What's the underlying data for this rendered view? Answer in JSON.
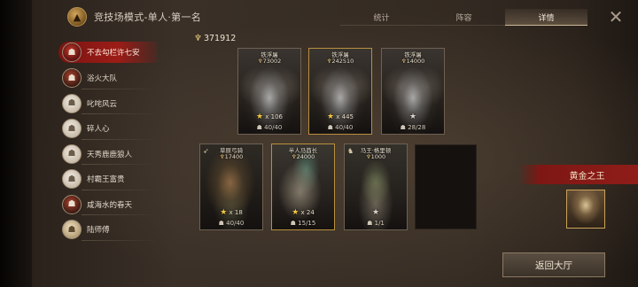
{
  "header": {
    "title": "竞技场模式-单人·第一名",
    "logo_icon": "crest-icon"
  },
  "tabs": [
    {
      "label": "统计",
      "active": false
    },
    {
      "label": "阵容",
      "active": false
    },
    {
      "label": "详情",
      "active": true
    }
  ],
  "players": [
    {
      "name": "不去勾栏许七安",
      "selected": true,
      "avatar": "red"
    },
    {
      "name": "浴火大队",
      "selected": false,
      "avatar": "dark"
    },
    {
      "name": "叱咤风云",
      "selected": false,
      "avatar": "light"
    },
    {
      "name": "碎人心",
      "selected": false,
      "avatar": "light"
    },
    {
      "name": "天秀鹿鹿狼人",
      "selected": false,
      "avatar": "light"
    },
    {
      "name": "村霸王富贵",
      "selected": false,
      "avatar": "light"
    },
    {
      "name": "咸海水的春天",
      "selected": false,
      "avatar": "dark"
    },
    {
      "name": "陆师傅",
      "selected": false,
      "avatar": "warm"
    }
  ],
  "total_power": "371912",
  "cards": [
    {
      "name": "铁浮屠",
      "power": "73002",
      "stars_text": "x 106",
      "troops": "40/40",
      "gold": false
    },
    {
      "name": "铁浮屠",
      "power": "242510",
      "stars_text": "x 445",
      "troops": "40/40",
      "gold": true
    },
    {
      "name": "铁浮屠",
      "power": "14000",
      "stars_text": "",
      "troops": "28/28",
      "gold": false
    },
    {
      "name": "草原弓骑",
      "power": "17400",
      "stars_text": "x 18",
      "troops": "40/40",
      "gold": false
    },
    {
      "name": "半人马酋长",
      "power": "24000",
      "stars_text": "x 24",
      "troops": "15/15",
      "gold": true
    },
    {
      "name": "马王·格里顿",
      "power": "1000",
      "stars_text": "",
      "troops": "1/1",
      "gold": false
    }
  ],
  "rank": {
    "title": "黄金之王"
  },
  "return_button": "返回大厅"
}
